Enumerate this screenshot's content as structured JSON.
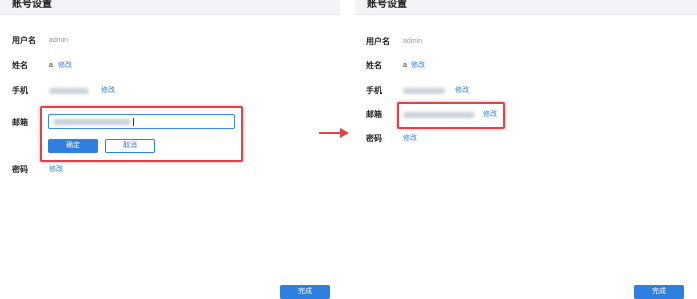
{
  "left": {
    "title": "账号设置",
    "username_label": "用户名",
    "username_value": "admin",
    "name_label": "姓名",
    "name_value": "a",
    "name_edit": "修改",
    "phone_label": "手机",
    "phone_edit": "修改",
    "email_label": "邮箱",
    "confirm_label": "确定",
    "cancel_label": "取消",
    "password_label": "密码",
    "password_edit": "修改",
    "done_label": "完成"
  },
  "right": {
    "title": "账号设置",
    "username_label": "用户名",
    "username_value": "admin",
    "name_label": "姓名",
    "name_value": "a",
    "name_edit": "修改",
    "phone_label": "手机",
    "phone_edit": "修改",
    "email_label": "邮箱",
    "email_edit": "修改",
    "password_label": "密码",
    "password_edit": "修改",
    "done_label": "完成"
  },
  "colors": {
    "accent": "#2f7fe0",
    "highlight": "#e0424a"
  },
  "icons": {
    "transition": "right-arrow-icon"
  }
}
